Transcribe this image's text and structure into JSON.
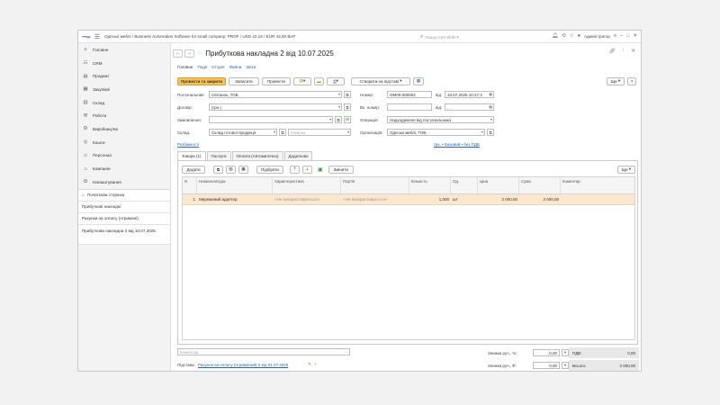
{
  "app": {
    "title": "Одеські меблі / Business Automation Software for small company: PROF / USD 42,16 / EUR 43,50 ВАР",
    "search_placeholder": "Пошук Ctrl+Shift+F",
    "user": "Адміністратор"
  },
  "sidebar": {
    "items": [
      {
        "label": "Головне",
        "icon": "home-icon"
      },
      {
        "label": "CRM",
        "icon": "crm-icon"
      },
      {
        "label": "Продажі",
        "icon": "sales-icon"
      },
      {
        "label": "Закупівлі",
        "icon": "purchases-icon"
      },
      {
        "label": "Склад",
        "icon": "warehouse-icon"
      },
      {
        "label": "Роботи",
        "icon": "works-icon"
      },
      {
        "label": "Виробництво",
        "icon": "production-icon"
      },
      {
        "label": "Кошти",
        "icon": "money-icon"
      },
      {
        "label": "Персонал",
        "icon": "staff-icon"
      },
      {
        "label": "Компанія",
        "icon": "company-icon"
      },
      {
        "label": "Налаштування",
        "icon": "settings-icon"
      }
    ],
    "open_windows": [
      {
        "label": "Початкова сторінка"
      },
      {
        "label": "Прибуткові накладні"
      },
      {
        "label": "Рахунки на оплату (отримані)"
      },
      {
        "label": "Прибуткова накладна 2 від 10.07.2025"
      }
    ]
  },
  "document": {
    "title": "Прибуткова накладна 2 від 10.07.2025",
    "tabs": [
      "Головне",
      "Події",
      "Історія",
      "Файли",
      "Звіти"
    ],
    "toolbar": {
      "post_close": "Провести та закрити",
      "save": "Записати",
      "post": "Провести",
      "create_based": "Створити на підставі",
      "more": "Ще"
    },
    "fields": {
      "supplier_label": "Постачальник:",
      "supplier": "Світанок, ТОВ",
      "contract_label": "Договір:",
      "contract": "(грн.)",
      "order_label": "Замовлення:",
      "warehouse_label": "Склад:",
      "warehouse": "Склад готової продукції",
      "cell_placeholder": "Комірка",
      "number_label": "Номер:",
      "number": "ОМ00-000002",
      "from_label": "від:",
      "date": "10.07.2025 10:27:3",
      "in_number_label": "Вх. номер:",
      "in_from_label": "від:",
      "in_date": " .  .  ",
      "operation_label": "Операція:",
      "operation": "Надходження від постачальника",
      "org_label": "Організація:",
      "org": "Одеські меблі, ТОВ",
      "details_link": "Розбіжності",
      "price_link": "грн. • Базовий • без ПДВ"
    },
    "inner_tabs": [
      "Товари (1)",
      "Послуги",
      "Оплата (Автоматично)",
      "Додатково"
    ],
    "grid_toolbar": {
      "add": "Додати",
      "pick": "Підібрати",
      "change": "Змінити",
      "more": "Ще"
    },
    "grid": {
      "columns": [
        "N",
        "Номенклатура",
        "Характеристика",
        "Партія",
        "Кількість",
        "Од.",
        "Ціна",
        "Сума",
        "Коментар"
      ],
      "rows": [
        {
          "n": "1",
          "item": "Мережевий адаптер",
          "characteristic": "<Не використовуються>",
          "batch": "<Не використовується>",
          "qty": "1,000",
          "unit": "шт",
          "price": "2 000,00",
          "sum": "2 000,00",
          "comment": ""
        }
      ]
    },
    "footer": {
      "comment_placeholder": "Коментар",
      "basis_label": "Підстава:",
      "basis_link": "Рахунок на оплату (отриманий) 2 від 01.07.2025",
      "discount_pct_label": "Знижка руч., %:",
      "discount_pct": "0,00",
      "discount_amt_label": "Знижка руч., ₴:",
      "discount_amt": "0,00",
      "vat_label": "ПДВ:",
      "vat": "0,00",
      "total_label": "Всього:",
      "total": "2 000,00"
    }
  }
}
